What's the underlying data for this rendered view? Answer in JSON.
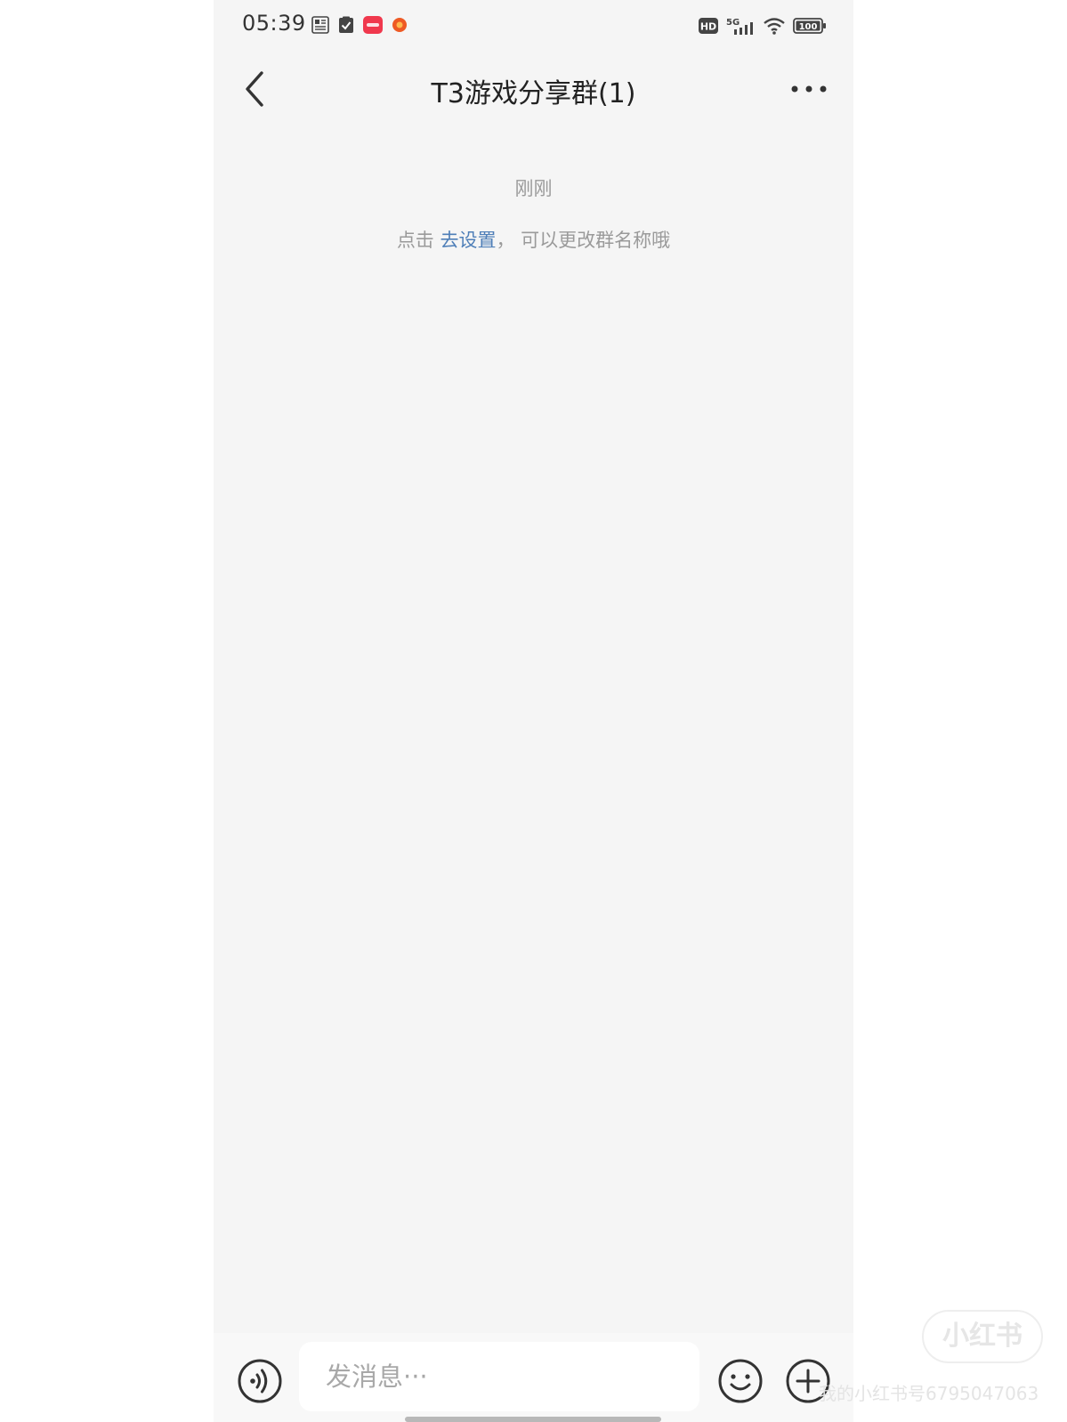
{
  "status_bar": {
    "time": "05:39",
    "left_icons": [
      "news-icon",
      "clipboard-check-icon",
      "red-app-icon",
      "orange-app-icon"
    ],
    "right_icons": [
      "hd-icon",
      "5g-signal-icon",
      "wifi-icon",
      "battery-icon"
    ],
    "hd_label": "HD",
    "network_label": "5G",
    "battery_label": "100"
  },
  "header": {
    "title": "T3游戏分享群(1)"
  },
  "messages": {
    "time_label": "刚刚",
    "notice_prefix": "点击 ",
    "notice_link": "去设置",
    "notice_suffix": "， 可以更改群名称哦"
  },
  "input_bar": {
    "placeholder": "发消息···"
  },
  "watermark": {
    "logo": "小红书",
    "text": "我的小红书号6795047063"
  },
  "colors": {
    "background": "#f5f5f5",
    "link": "#4f7fb8",
    "muted_text": "#9a9a9a",
    "title_text": "#222222"
  }
}
